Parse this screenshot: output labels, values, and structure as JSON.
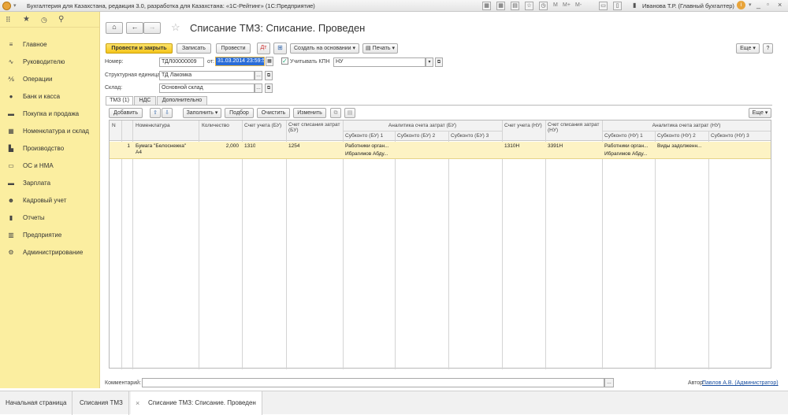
{
  "titlebar": {
    "title": "Бухгалтерия для Казахстана, редакция 3.0, разработка для Казахстана: «1С-Рейтинг» (1С:Предприятие)",
    "user": "Иванова Т.Р. (Главный бухгалтер)",
    "m": "M",
    "mplus": "M+",
    "mminus": "M-"
  },
  "sidebar": {
    "items": [
      {
        "label": "Главное",
        "icon": "≡"
      },
      {
        "label": "Руководителю",
        "icon": "∿"
      },
      {
        "label": "Операции",
        "icon": "⅍"
      },
      {
        "label": "Банк и касса",
        "icon": "●"
      },
      {
        "label": "Покупка и продажа",
        "icon": "▬"
      },
      {
        "label": "Номенклатура и склад",
        "icon": "▦"
      },
      {
        "label": "Производство",
        "icon": "▙"
      },
      {
        "label": "ОС и НМА",
        "icon": "▭"
      },
      {
        "label": "Зарплата",
        "icon": "▬"
      },
      {
        "label": "Кадровый учет",
        "icon": "☻"
      },
      {
        "label": "Отчеты",
        "icon": "▮"
      },
      {
        "label": "Предприятие",
        "icon": "▥"
      },
      {
        "label": "Администрирование",
        "icon": "⚙"
      }
    ]
  },
  "doc": {
    "title": "Списание ТМЗ: Списание. Проведен",
    "more": "Еще",
    "help": "?"
  },
  "toolbar": {
    "post_close": "Провести и закрыть",
    "save": "Записать",
    "post": "Провести",
    "create_based": "Создать на основании",
    "print": "Печать",
    "more": "Еще"
  },
  "form": {
    "number_label": "Номер:",
    "number": "ТДЛ00000009",
    "from_label": "от:",
    "date": "31.03.2014 23:59:59",
    "kpn_label": "Учитывать КПН",
    "kpn_value": "НУ",
    "unit_label": "Структурная единица:",
    "unit": "ТД Лакомка",
    "warehouse_label": "Склад:",
    "warehouse": "Основной склад"
  },
  "tabs": [
    "ТМЗ (1)",
    "НДС",
    "Дополнительно"
  ],
  "table_toolbar": {
    "add": "Добавить",
    "fill": "Заполнить",
    "select": "Подбор",
    "clear": "Очистить",
    "change": "Изменить",
    "more": "Еще"
  },
  "table": {
    "headers": {
      "n": "N",
      "item": "Номенклатура",
      "qty": "Количество",
      "acc_bu": "Счет учета (БУ)",
      "acc_wo_bu": "Счет списания затрат (БУ)",
      "analytics_bu": "Аналитика счета затрат (БУ)",
      "sub_bu1": "Субконто (БУ) 1",
      "sub_bu2": "Субконто (БУ) 2",
      "sub_bu3": "Субконто (БУ) 3",
      "acc_nu": "Счет учета (НУ)",
      "acc_wo_nu": "Счет списания затрат (НУ)",
      "analytics_nu": "Аналитика счета затрат (НУ)",
      "sub_nu1": "Субконто (НУ) 1",
      "sub_nu2": "Субконто (НУ) 2",
      "sub_nu3": "Субконто (НУ) 3"
    },
    "row": {
      "n": "1",
      "item1": "Бумага \"Белоснежка\"",
      "item2": "А4",
      "qty": "2,000",
      "acc_bu": "1310",
      "acc_wo_bu": "1254",
      "sub_bu1a": "Работники орган...",
      "sub_bu1b": "Ибрагимов Абду...",
      "acc_nu": "1310Н",
      "acc_wo_nu": "3391Н",
      "sub_nu1a": "Работники орган...",
      "sub_nu1b": "Ибрагимов Абду...",
      "sub_nu2": "Виды задолженн..."
    }
  },
  "footer": {
    "comment_label": "Комментарий:",
    "author_label": "Автор:",
    "author": "Павлов А.В. (Администратор)"
  },
  "bottom_tabs": [
    "Начальная страница",
    "Списания ТМЗ",
    "Списание ТМЗ: Списание. Проведен"
  ],
  "colors": {
    "accent": "#f5c51a",
    "sidebar": "#fbeea0",
    "row": "#fdf3c4"
  }
}
